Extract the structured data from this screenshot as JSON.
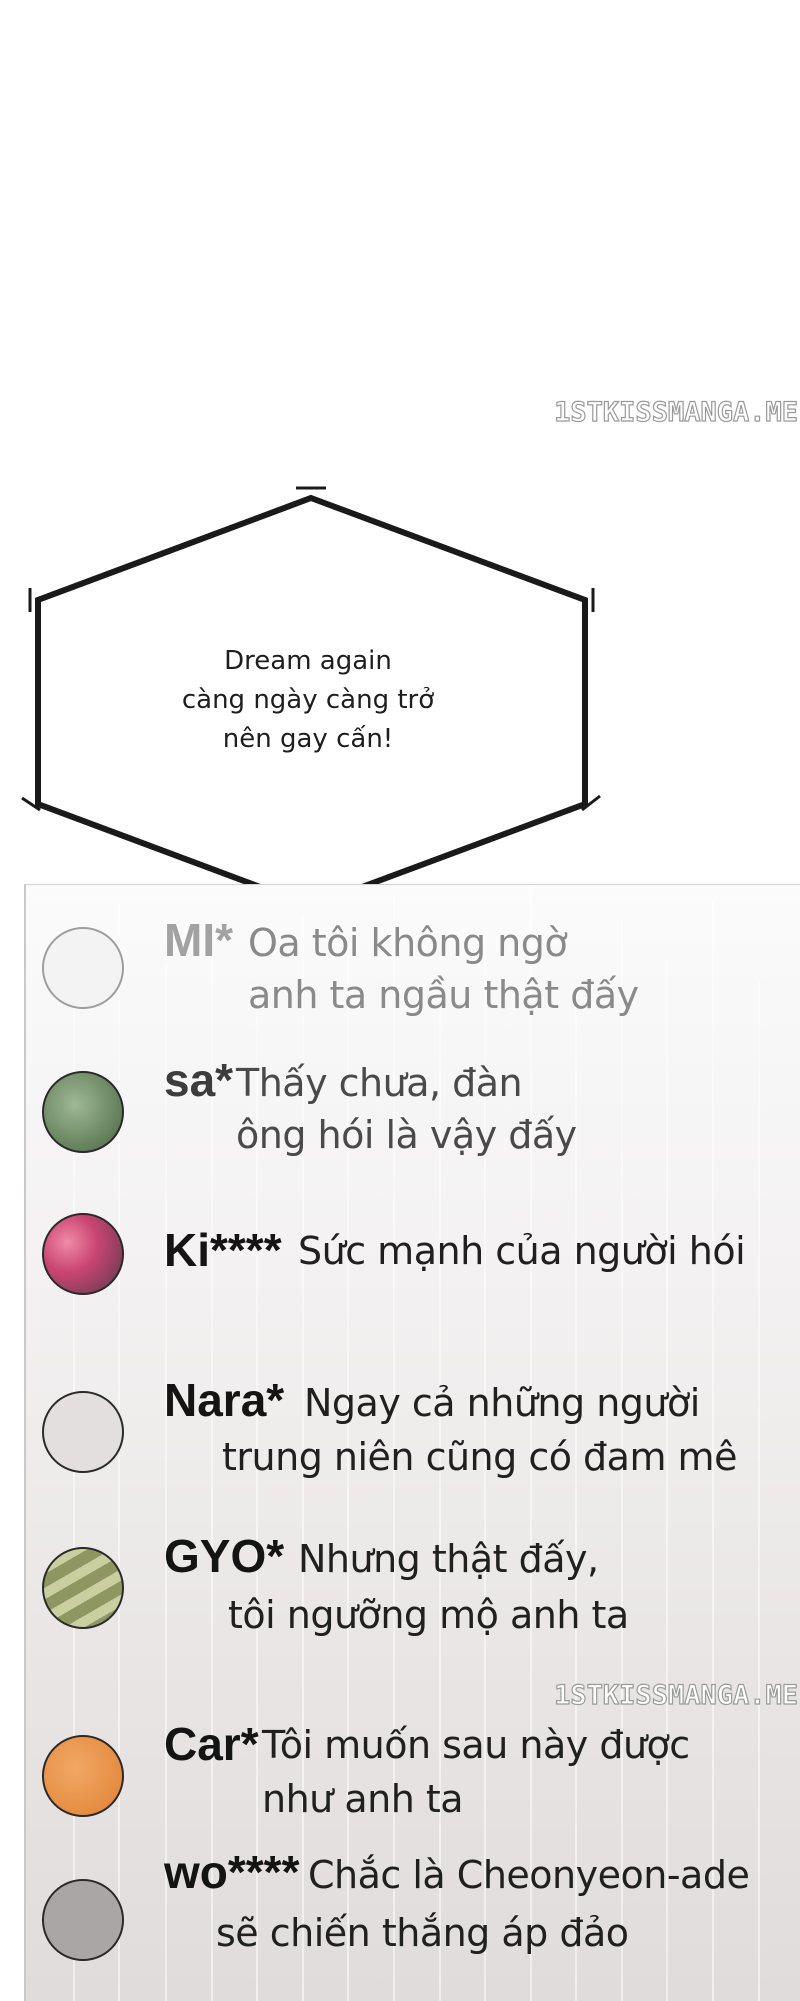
{
  "watermarks": {
    "top": "1STKISSMANGA.ME",
    "middle": "1STKISSMANGA.ME"
  },
  "bubble": {
    "line1": "Dream again",
    "line2": "càng ngày càng trở",
    "line3": "nên gay cấn!"
  },
  "comments": [
    {
      "name": "MI*",
      "line1": "Oa tôi không ngờ",
      "line2": "anh ta ngầu thật đấy",
      "avatar_color": "#f2f2f2",
      "avatar_icon": "blank-avatar-icon"
    },
    {
      "name": "sa*",
      "line1": "Thấy chưa, đàn",
      "line2": "ông hói là vậy đấy",
      "avatar_color": "#7d9a74",
      "avatar_icon": "green-leaf-avatar-icon"
    },
    {
      "name": "Ki****",
      "line1": "Sức mạnh của người hói",
      "line2": "",
      "avatar_color": "#c8557a",
      "avatar_icon": "pink-hearts-avatar-icon"
    },
    {
      "name": "Nara*",
      "line1": "Ngay cả những người",
      "line2": "trung niên cũng có đam mê",
      "avatar_color": "#e2dede",
      "avatar_icon": "blank-avatar-icon"
    },
    {
      "name": "GYO*",
      "line1": "Nhưng thật đấy,",
      "line2": "tôi ngưỡng mộ anh ta",
      "avatar_color": "#a5ad78",
      "avatar_icon": "striped-avatar-icon"
    },
    {
      "name": "Car*",
      "line1": "Tôi muốn sau này được",
      "line2": "như anh ta",
      "avatar_color": "#e8954e",
      "avatar_icon": "orange-avatar-icon"
    },
    {
      "name": "wo****",
      "line1": "Chắc là Cheonyeon-ade",
      "line2": "sẽ chiến thắng áp đảo",
      "avatar_color": "#a9a5a5",
      "avatar_icon": "gray-avatar-icon"
    }
  ]
}
